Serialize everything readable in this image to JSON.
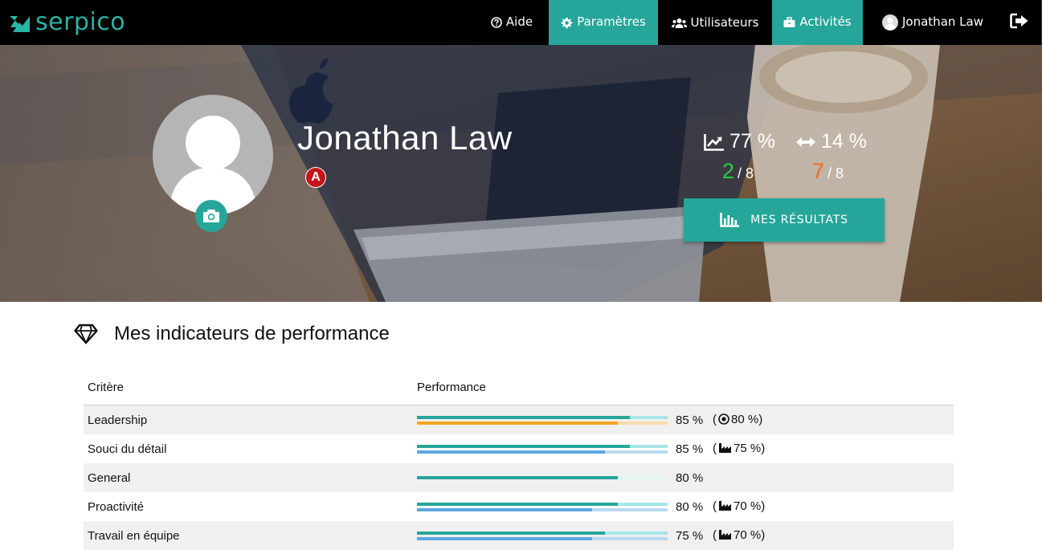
{
  "app": {
    "brand": "serpico"
  },
  "nav": {
    "help": "Aide",
    "settings": "Paramètres",
    "users": "Utilisateurs",
    "activities": "Activités",
    "user_name": "Jonathan Law"
  },
  "colors": {
    "teal": "#26a69a",
    "green_score": "#2ecc40",
    "orange_score": "#f26a1b",
    "bar_main": "#26a69a",
    "bar_main_track": "#a6e6e6",
    "bar_goal": "#f5a623",
    "bar_goal_track": "#f8dcae",
    "bar_bench": "#5aa7e0",
    "bar_bench_track": "#b9d9ef"
  },
  "profile": {
    "name": "Jonathan Law",
    "role_badge": "A",
    "stat_trend": "77 %",
    "stat_range": "14 %",
    "score_good": "2",
    "score_good_total": "/ 8",
    "score_bad": "7",
    "score_bad_total": "/ 8",
    "results_button": "MES RÉSULTATS"
  },
  "section": {
    "title": "Mes indicateurs de performance",
    "col_criterion": "Critère",
    "col_performance": "Performance"
  },
  "criteria": [
    {
      "label": "Leadership",
      "value": 0.85,
      "pct": "85 %",
      "ref_type": "target",
      "ref_value": 0.8,
      "ref_text": "80 %)"
    },
    {
      "label": "Souci du détail",
      "value": 0.85,
      "pct": "85 %",
      "ref_type": "benchmark",
      "ref_value": 0.75,
      "ref_text": "75 %)"
    },
    {
      "label": "General",
      "value": 0.8,
      "pct": "80 %",
      "ref_type": "none",
      "ref_value": null,
      "ref_text": ""
    },
    {
      "label": "Proactivité",
      "value": 0.8,
      "pct": "80 %",
      "ref_type": "benchmark",
      "ref_value": 0.7,
      "ref_text": "70 %)"
    },
    {
      "label": "Travail en équipe",
      "value": 0.75,
      "pct": "75 %",
      "ref_type": "benchmark",
      "ref_value": 0.7,
      "ref_text": "70 %)"
    }
  ]
}
